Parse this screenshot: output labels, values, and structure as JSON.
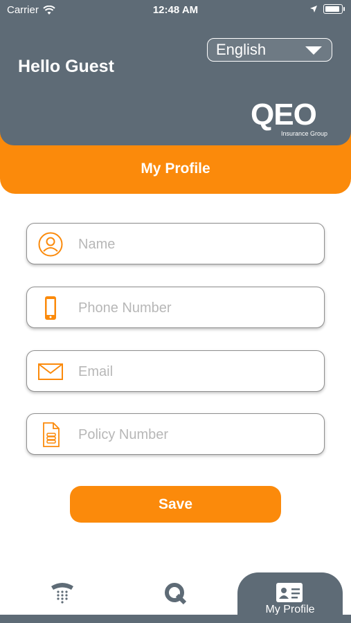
{
  "status_bar": {
    "carrier": "Carrier",
    "time": "12:48 AM"
  },
  "header": {
    "greeting": "Hello Guest",
    "language": "English",
    "logo_text": "QEO",
    "logo_subtitle": "Insurance Group"
  },
  "page_title": "My Profile",
  "form": {
    "fields": [
      {
        "placeholder": "Name",
        "value": "",
        "icon": "user-icon"
      },
      {
        "placeholder": "Phone Number",
        "value": "",
        "icon": "phone-icon"
      },
      {
        "placeholder": "Email",
        "value": "",
        "icon": "envelope-icon"
      },
      {
        "placeholder": "Policy Number",
        "value": "",
        "icon": "document-icon"
      }
    ],
    "save_label": "Save"
  },
  "tab_bar": {
    "tabs": [
      {
        "label": "",
        "icon": "telephone-icon"
      },
      {
        "label": "",
        "icon": "q-logo-icon"
      },
      {
        "label": "My Profile",
        "icon": "id-card-icon",
        "active": true
      }
    ]
  },
  "colors": {
    "accent": "#fb8a0b",
    "header_bg": "#5e6b76"
  }
}
